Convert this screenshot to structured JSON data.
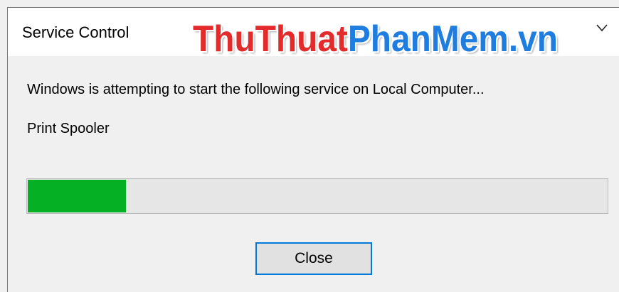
{
  "dialog": {
    "title": "Service Control",
    "message": "Windows is attempting to start the following service on Local Computer...",
    "service_name": "Print Spooler",
    "progress_fraction": 0.17,
    "close_label": "Close"
  },
  "watermark": {
    "part1": "ThuThuat",
    "part2": "PhanMem.vn",
    "color_red": "#e32b2b",
    "color_blue": "#1f7de0"
  },
  "colors": {
    "progress_fill": "#06b025",
    "button_border": "#0078d7"
  },
  "icons": {
    "title_chevron": "chevron-down-icon"
  }
}
